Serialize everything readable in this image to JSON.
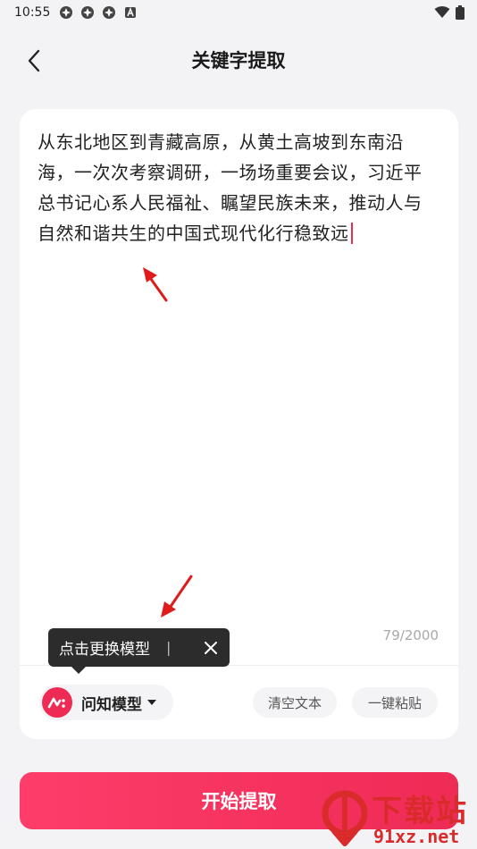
{
  "status_bar": {
    "time": "10:55",
    "left_icons": [
      "app-notification-icon",
      "app-notification-icon",
      "app-notification-icon",
      "keyboard-a-icon"
    ],
    "right_icons": [
      "wifi-icon",
      "battery-icon"
    ]
  },
  "app_bar": {
    "title": "关键字提取",
    "back_icon": "chevron-left-icon"
  },
  "editor": {
    "text": "从东北地区到青藏高原，从黄土高坡到东南沿海，一次次考察调研，一场场重要会议，习近平总书记心系人民福祉、瞩望民族未来，推动人与自然和谐共生的中国式现代化行稳致远",
    "counter": "79/2000"
  },
  "toolbar": {
    "model_name": "问知模型",
    "clear_label": "清空文本",
    "paste_label": "一键粘贴"
  },
  "tooltip": {
    "text": "点击更换模型",
    "separator": "|"
  },
  "start_button": {
    "label": "开始提取"
  },
  "watermark": {
    "line1": "下载站",
    "line2": "91xz.net"
  },
  "colors": {
    "accent": "#ee2b55",
    "annotation_arrow": "#e01b1b",
    "background": "#f3f3f6"
  }
}
